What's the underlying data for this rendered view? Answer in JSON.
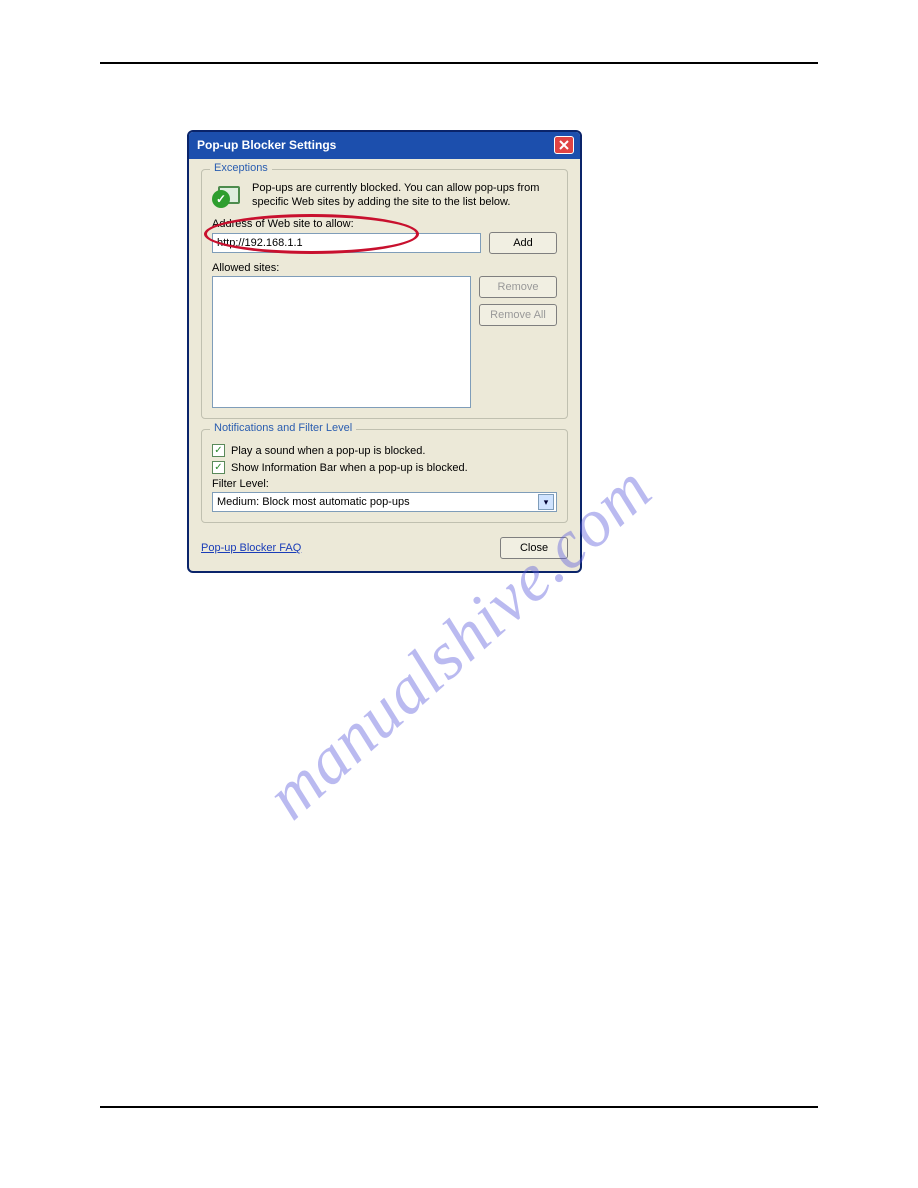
{
  "dialog": {
    "title": "Pop-up Blocker Settings",
    "exceptions": {
      "legend": "Exceptions",
      "desc": "Pop-ups are currently blocked. You can allow pop-ups from specific Web sites by adding the site to the list below.",
      "address_label": "Address of Web site to allow:",
      "address_value": "http://192.168.1.1",
      "add_label": "Add",
      "allowed_label": "Allowed sites:",
      "remove_label": "Remove",
      "remove_all_label": "Remove All"
    },
    "notifications": {
      "legend": "Notifications and Filter Level",
      "play_sound": "Play a sound when a pop-up is blocked.",
      "show_infobar": "Show Information Bar when a pop-up is blocked.",
      "filter_level_label": "Filter Level:",
      "filter_level_value": "Medium: Block most automatic pop-ups"
    },
    "faq_link": "Pop-up Blocker FAQ",
    "close_label": "Close"
  },
  "watermark": "manualshive.com"
}
